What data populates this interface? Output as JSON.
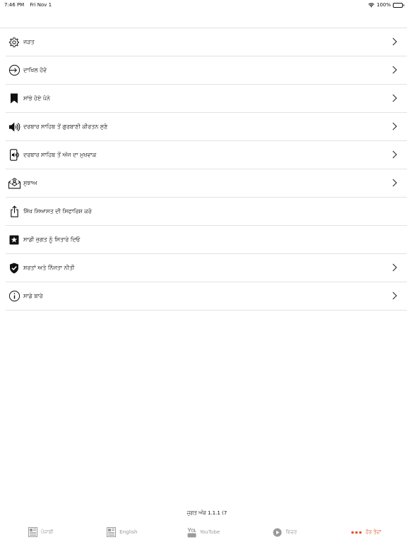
{
  "status_bar": {
    "time": "7:46 PM",
    "date": "Fri Nov 1",
    "battery": "100%"
  },
  "menu": {
    "items": [
      {
        "label": "ਜੜਤ",
        "icon": "gear-icon",
        "chevron": true
      },
      {
        "label": "ਦਾਖਿਲ ਹੋਵੋ",
        "icon": "login-icon",
        "chevron": true
      },
      {
        "label": "ਸਾਂਭੇ ਹੋਏ ਪੰਨੇ",
        "icon": "bookmark-icon",
        "chevron": true
      },
      {
        "label": "ਦਰਬਾਰ ਸਾਹਿਬ ਤੋਂ ਗੁਰਬਾਣੀ ਕੀਰਤਨ ਸੁਣੋ",
        "icon": "speaker-icon",
        "chevron": true
      },
      {
        "label": "ਦਰਬਾਰ ਸਾਹਿਬ ਤੋਂ ਅੱਜ ਦਾ ਮੁਖਵਾਕ",
        "icon": "phone-audio-icon",
        "chevron": true
      },
      {
        "label": "ਸੁਝਾਅ",
        "icon": "mail-user-icon",
        "chevron": true
      },
      {
        "label": "ਸਿੱਖ ਸਿਆਸਤ ਦੀ ਸਿਫਾਰਿਸ਼ ਕਰੋ",
        "icon": "share-icon",
        "chevron": false
      },
      {
        "label": "ਸਾਡੀ ਜੁਗਤ ਨੂੰ ਸਿਤਾਰੇ ਦਿਓ",
        "icon": "star-box-icon",
        "chevron": false
      },
      {
        "label": "ਸ਼ਰਤਾਂ ਅਤੇ ਨਿੱਜਤਾ ਨੀਤੀ",
        "icon": "shield-check-icon",
        "chevron": true
      },
      {
        "label": "ਸਾਡੇ ਬਾਰੇ",
        "icon": "info-icon",
        "chevron": true
      }
    ]
  },
  "version_text": "ਜੁਗਤ ਅੰਕ 1.1.1 (7",
  "tabbar": {
    "tabs": [
      {
        "label": "ਪੰਜਾਬੀ",
        "icon": "article-icon",
        "active": false
      },
      {
        "label": "English",
        "icon": "article-icon",
        "active": false
      },
      {
        "label": "YouTube",
        "icon": "youtube-icon",
        "active": false
      },
      {
        "label": "ਵਿਚਰ",
        "icon": "play-circle-icon",
        "active": false
      },
      {
        "label": "ਹੋਰ ਤੰਦਾਂ",
        "icon": "more-dots-icon",
        "active": true
      }
    ]
  },
  "colors": {
    "accent": "#e8512d",
    "divider": "#e2e2e2",
    "inactive_tab": "#9a9a9a"
  }
}
